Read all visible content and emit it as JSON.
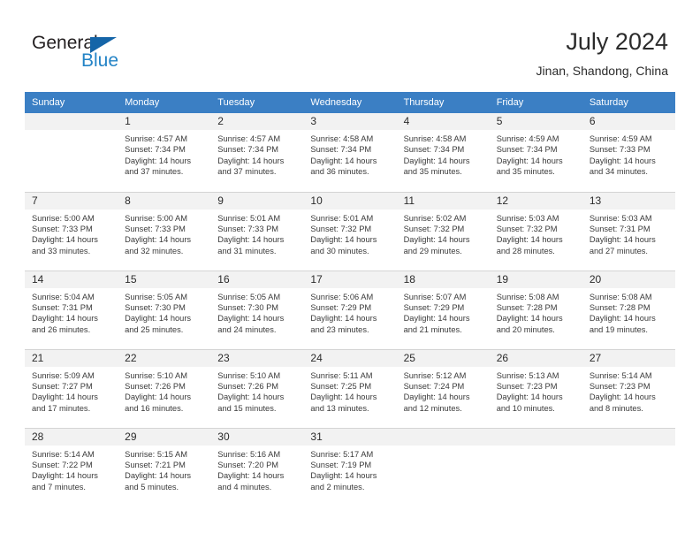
{
  "brand": {
    "name_part1": "General",
    "name_part2": "Blue",
    "triangle_color": "#1565a8",
    "blue_color": "#2383c6"
  },
  "header": {
    "title": "July 2024",
    "subtitle": "Jinan, Shandong, China"
  },
  "colors": {
    "header_row_bg": "#3b7fc4",
    "header_row_text": "#ffffff",
    "daynum_bg": "#f2f2f2",
    "cell_border": "#d4d4d4",
    "body_text": "#3a3a3a"
  },
  "weekdays": [
    "Sunday",
    "Monday",
    "Tuesday",
    "Wednesday",
    "Thursday",
    "Friday",
    "Saturday"
  ],
  "weeks": [
    [
      {
        "day": "",
        "sunrise": "",
        "sunset": "",
        "daylight_l1": "",
        "daylight_l2": "",
        "empty": true
      },
      {
        "day": "1",
        "sunrise": "Sunrise: 4:57 AM",
        "sunset": "Sunset: 7:34 PM",
        "daylight_l1": "Daylight: 14 hours",
        "daylight_l2": "and 37 minutes."
      },
      {
        "day": "2",
        "sunrise": "Sunrise: 4:57 AM",
        "sunset": "Sunset: 7:34 PM",
        "daylight_l1": "Daylight: 14 hours",
        "daylight_l2": "and 37 minutes."
      },
      {
        "day": "3",
        "sunrise": "Sunrise: 4:58 AM",
        "sunset": "Sunset: 7:34 PM",
        "daylight_l1": "Daylight: 14 hours",
        "daylight_l2": "and 36 minutes."
      },
      {
        "day": "4",
        "sunrise": "Sunrise: 4:58 AM",
        "sunset": "Sunset: 7:34 PM",
        "daylight_l1": "Daylight: 14 hours",
        "daylight_l2": "and 35 minutes."
      },
      {
        "day": "5",
        "sunrise": "Sunrise: 4:59 AM",
        "sunset": "Sunset: 7:34 PM",
        "daylight_l1": "Daylight: 14 hours",
        "daylight_l2": "and 35 minutes."
      },
      {
        "day": "6",
        "sunrise": "Sunrise: 4:59 AM",
        "sunset": "Sunset: 7:33 PM",
        "daylight_l1": "Daylight: 14 hours",
        "daylight_l2": "and 34 minutes."
      }
    ],
    [
      {
        "day": "7",
        "sunrise": "Sunrise: 5:00 AM",
        "sunset": "Sunset: 7:33 PM",
        "daylight_l1": "Daylight: 14 hours",
        "daylight_l2": "and 33 minutes."
      },
      {
        "day": "8",
        "sunrise": "Sunrise: 5:00 AM",
        "sunset": "Sunset: 7:33 PM",
        "daylight_l1": "Daylight: 14 hours",
        "daylight_l2": "and 32 minutes."
      },
      {
        "day": "9",
        "sunrise": "Sunrise: 5:01 AM",
        "sunset": "Sunset: 7:33 PM",
        "daylight_l1": "Daylight: 14 hours",
        "daylight_l2": "and 31 minutes."
      },
      {
        "day": "10",
        "sunrise": "Sunrise: 5:01 AM",
        "sunset": "Sunset: 7:32 PM",
        "daylight_l1": "Daylight: 14 hours",
        "daylight_l2": "and 30 minutes."
      },
      {
        "day": "11",
        "sunrise": "Sunrise: 5:02 AM",
        "sunset": "Sunset: 7:32 PM",
        "daylight_l1": "Daylight: 14 hours",
        "daylight_l2": "and 29 minutes."
      },
      {
        "day": "12",
        "sunrise": "Sunrise: 5:03 AM",
        "sunset": "Sunset: 7:32 PM",
        "daylight_l1": "Daylight: 14 hours",
        "daylight_l2": "and 28 minutes."
      },
      {
        "day": "13",
        "sunrise": "Sunrise: 5:03 AM",
        "sunset": "Sunset: 7:31 PM",
        "daylight_l1": "Daylight: 14 hours",
        "daylight_l2": "and 27 minutes."
      }
    ],
    [
      {
        "day": "14",
        "sunrise": "Sunrise: 5:04 AM",
        "sunset": "Sunset: 7:31 PM",
        "daylight_l1": "Daylight: 14 hours",
        "daylight_l2": "and 26 minutes."
      },
      {
        "day": "15",
        "sunrise": "Sunrise: 5:05 AM",
        "sunset": "Sunset: 7:30 PM",
        "daylight_l1": "Daylight: 14 hours",
        "daylight_l2": "and 25 minutes."
      },
      {
        "day": "16",
        "sunrise": "Sunrise: 5:05 AM",
        "sunset": "Sunset: 7:30 PM",
        "daylight_l1": "Daylight: 14 hours",
        "daylight_l2": "and 24 minutes."
      },
      {
        "day": "17",
        "sunrise": "Sunrise: 5:06 AM",
        "sunset": "Sunset: 7:29 PM",
        "daylight_l1": "Daylight: 14 hours",
        "daylight_l2": "and 23 minutes."
      },
      {
        "day": "18",
        "sunrise": "Sunrise: 5:07 AM",
        "sunset": "Sunset: 7:29 PM",
        "daylight_l1": "Daylight: 14 hours",
        "daylight_l2": "and 21 minutes."
      },
      {
        "day": "19",
        "sunrise": "Sunrise: 5:08 AM",
        "sunset": "Sunset: 7:28 PM",
        "daylight_l1": "Daylight: 14 hours",
        "daylight_l2": "and 20 minutes."
      },
      {
        "day": "20",
        "sunrise": "Sunrise: 5:08 AM",
        "sunset": "Sunset: 7:28 PM",
        "daylight_l1": "Daylight: 14 hours",
        "daylight_l2": "and 19 minutes."
      }
    ],
    [
      {
        "day": "21",
        "sunrise": "Sunrise: 5:09 AM",
        "sunset": "Sunset: 7:27 PM",
        "daylight_l1": "Daylight: 14 hours",
        "daylight_l2": "and 17 minutes."
      },
      {
        "day": "22",
        "sunrise": "Sunrise: 5:10 AM",
        "sunset": "Sunset: 7:26 PM",
        "daylight_l1": "Daylight: 14 hours",
        "daylight_l2": "and 16 minutes."
      },
      {
        "day": "23",
        "sunrise": "Sunrise: 5:10 AM",
        "sunset": "Sunset: 7:26 PM",
        "daylight_l1": "Daylight: 14 hours",
        "daylight_l2": "and 15 minutes."
      },
      {
        "day": "24",
        "sunrise": "Sunrise: 5:11 AM",
        "sunset": "Sunset: 7:25 PM",
        "daylight_l1": "Daylight: 14 hours",
        "daylight_l2": "and 13 minutes."
      },
      {
        "day": "25",
        "sunrise": "Sunrise: 5:12 AM",
        "sunset": "Sunset: 7:24 PM",
        "daylight_l1": "Daylight: 14 hours",
        "daylight_l2": "and 12 minutes."
      },
      {
        "day": "26",
        "sunrise": "Sunrise: 5:13 AM",
        "sunset": "Sunset: 7:23 PM",
        "daylight_l1": "Daylight: 14 hours",
        "daylight_l2": "and 10 minutes."
      },
      {
        "day": "27",
        "sunrise": "Sunrise: 5:14 AM",
        "sunset": "Sunset: 7:23 PM",
        "daylight_l1": "Daylight: 14 hours",
        "daylight_l2": "and 8 minutes."
      }
    ],
    [
      {
        "day": "28",
        "sunrise": "Sunrise: 5:14 AM",
        "sunset": "Sunset: 7:22 PM",
        "daylight_l1": "Daylight: 14 hours",
        "daylight_l2": "and 7 minutes."
      },
      {
        "day": "29",
        "sunrise": "Sunrise: 5:15 AM",
        "sunset": "Sunset: 7:21 PM",
        "daylight_l1": "Daylight: 14 hours",
        "daylight_l2": "and 5 minutes."
      },
      {
        "day": "30",
        "sunrise": "Sunrise: 5:16 AM",
        "sunset": "Sunset: 7:20 PM",
        "daylight_l1": "Daylight: 14 hours",
        "daylight_l2": "and 4 minutes."
      },
      {
        "day": "31",
        "sunrise": "Sunrise: 5:17 AM",
        "sunset": "Sunset: 7:19 PM",
        "daylight_l1": "Daylight: 14 hours",
        "daylight_l2": "and 2 minutes."
      },
      {
        "day": "",
        "sunrise": "",
        "sunset": "",
        "daylight_l1": "",
        "daylight_l2": "",
        "empty": true
      },
      {
        "day": "",
        "sunrise": "",
        "sunset": "",
        "daylight_l1": "",
        "daylight_l2": "",
        "empty": true
      },
      {
        "day": "",
        "sunrise": "",
        "sunset": "",
        "daylight_l1": "",
        "daylight_l2": "",
        "empty": true
      }
    ]
  ]
}
